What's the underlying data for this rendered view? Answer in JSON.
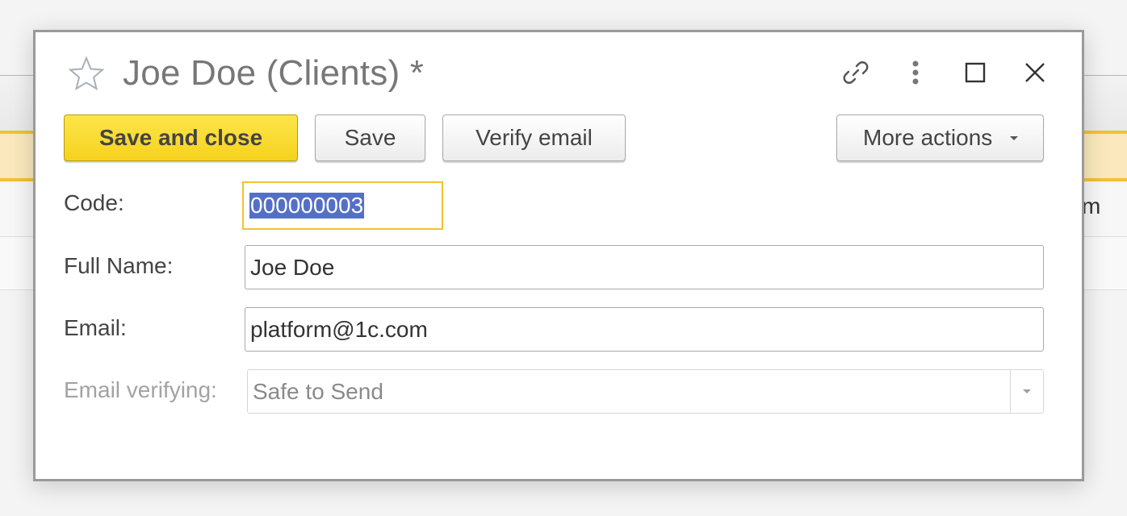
{
  "background": {
    "visible_row_fragment": "m"
  },
  "dialog": {
    "title": "Joe Doe (Clients) *",
    "icons": {
      "favorite": "star-icon",
      "link": "link-icon",
      "menu": "more-vertical-icon",
      "maximize": "maximize-icon",
      "close": "close-icon"
    },
    "toolbar": {
      "save_and_close_label": "Save and close",
      "save_label": "Save",
      "verify_email_label": "Verify email",
      "more_actions_label": "More actions"
    },
    "form": {
      "code": {
        "label": "Code:",
        "value": "000000003"
      },
      "full_name": {
        "label": "Full Name:",
        "value": "Joe Doe"
      },
      "email": {
        "label": "Email:",
        "value": "platform@1c.com"
      },
      "email_verifying": {
        "label": "Email verifying:",
        "value": "Safe to Send"
      }
    },
    "colors": {
      "primary_button": "#f5d21e",
      "focus_border": "#f1c232",
      "selection": "#5470c6"
    }
  }
}
